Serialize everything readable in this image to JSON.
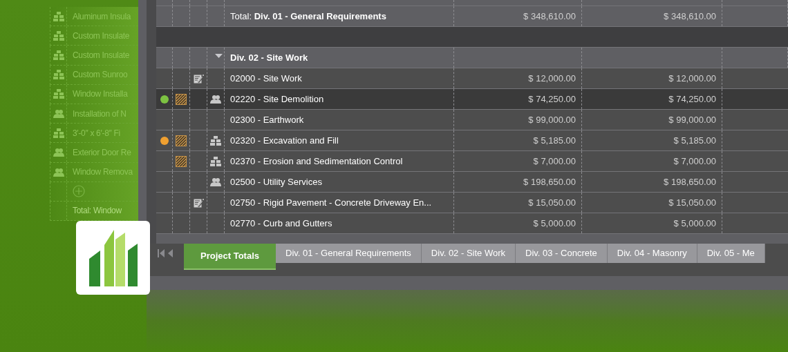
{
  "side_list": {
    "rows": [
      {
        "kind": "materials",
        "label": "Aluminum Insula"
      },
      {
        "kind": "materials",
        "label": "Custom Insulate"
      },
      {
        "kind": "materials",
        "label": "Custom Insulate"
      },
      {
        "kind": "materials",
        "label": "Custom Sunroo"
      },
      {
        "kind": "materials",
        "label": "Window Installa"
      },
      {
        "kind": "labor",
        "label": "Installation of N"
      },
      {
        "kind": "materials",
        "label": "3′-0″ x 6′-8″  Fi"
      },
      {
        "kind": "labor",
        "label": "Exterior Door Re"
      },
      {
        "kind": "labor",
        "label": "Window Remova"
      },
      {
        "kind": "add"
      },
      {
        "kind": "total",
        "label": "Total:  Window"
      }
    ]
  },
  "table": {
    "rows": [
      {
        "kind": "blank"
      },
      {
        "kind": "total",
        "name": "Total: **Div. 01 - General Requirements**",
        "amount_1": "$ 348,610.00",
        "amount_2": "$ 348,610.00"
      },
      {
        "kind": "gap"
      },
      {
        "kind": "group",
        "name": "Div. 02 - Site Work",
        "expanded": true
      },
      {
        "kind": "item",
        "selected": false,
        "hatched": false,
        "note": true,
        "labor": false,
        "materials": false,
        "name": "02000 - Site Work",
        "amount_1": "$ 12,000.00",
        "amount_2": "$ 12,000.00"
      },
      {
        "kind": "item",
        "selected": true,
        "color": "#7dc242",
        "hatched": true,
        "note": false,
        "labor": true,
        "materials": false,
        "name": "02220 - Site Demolition",
        "amount_1": "$ 74,250.00",
        "amount_2": "$ 74,250.00"
      },
      {
        "kind": "item",
        "selected": false,
        "hatched": false,
        "note": false,
        "labor": false,
        "materials": false,
        "name": "02300 - Earthwork",
        "amount_1": "$ 99,000.00",
        "amount_2": "$ 99,000.00"
      },
      {
        "kind": "item",
        "selected": false,
        "color": "#f0a030",
        "hatched": true,
        "note": false,
        "labor": false,
        "materials": true,
        "name": "02320 - Excavation and Fill",
        "amount_1": "$ 5,185.00",
        "amount_2": "$ 5,185.00"
      },
      {
        "kind": "item",
        "selected": false,
        "hatched": true,
        "note": false,
        "labor": false,
        "materials": true,
        "name": "02370 - Erosion and Sedimentation Control",
        "amount_1": "$ 7,000.00",
        "amount_2": "$ 7,000.00"
      },
      {
        "kind": "item",
        "selected": false,
        "hatched": false,
        "note": false,
        "labor": true,
        "materials": false,
        "name": "02500 - Utility Services",
        "amount_1": "$ 198,650.00",
        "amount_2": "$ 198,650.00"
      },
      {
        "kind": "item",
        "selected": false,
        "hatched": false,
        "note": true,
        "labor": false,
        "materials": false,
        "name": "02750 - Rigid Pavement - Concrete Driveway En...",
        "amount_1": "$ 15,050.00",
        "amount_2": "$ 15,050.00"
      },
      {
        "kind": "item",
        "selected": false,
        "hatched": false,
        "note": false,
        "labor": false,
        "materials": false,
        "name": "02770 - Curb and Gutters",
        "amount_1": "$ 5,000.00",
        "amount_2": "$ 5,000.00"
      }
    ]
  },
  "tabs": [
    {
      "label": "Project Totals",
      "selected": true
    },
    {
      "label": "Div. 01 - General Requirements",
      "selected": false
    },
    {
      "label": "Div. 02 - Site Work",
      "selected": false
    },
    {
      "label": "Div. 03 - Concrete",
      "selected": false
    },
    {
      "label": "Div. 04 - Masonry",
      "selected": false
    },
    {
      "label": "Div. 05 - Me",
      "selected": false
    }
  ]
}
